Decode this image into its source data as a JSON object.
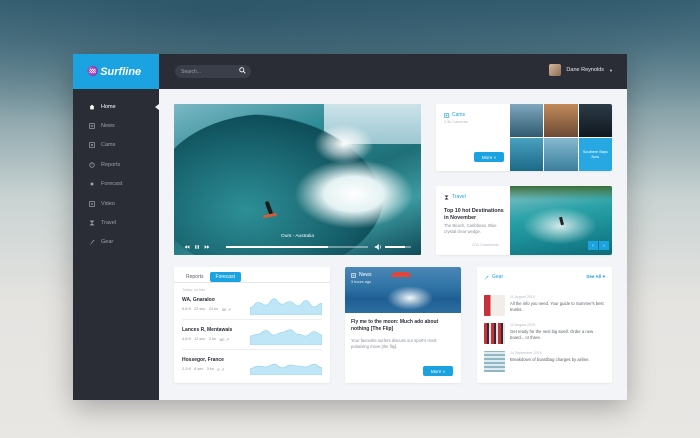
{
  "brand": {
    "name": "Surfline",
    "accent": "#1aa3e0",
    "dark": "#2a2d36"
  },
  "search": {
    "placeholder": "Search..."
  },
  "user": {
    "name": "Dane Reynolds"
  },
  "sidebar": {
    "items": [
      {
        "label": "Home",
        "icon": "home-icon",
        "active": true
      },
      {
        "label": "News",
        "icon": "news-icon"
      },
      {
        "label": "Cams",
        "icon": "camera-icon"
      },
      {
        "label": "Reports",
        "icon": "reports-icon"
      },
      {
        "label": "Forecast",
        "icon": "forecast-icon"
      },
      {
        "label": "Video",
        "icon": "video-icon"
      },
      {
        "label": "Travel",
        "icon": "travel-icon"
      },
      {
        "label": "Gear",
        "icon": "gear-icon"
      }
    ]
  },
  "video": {
    "caption": "Ours - Australia",
    "progress_fraction": 0.72,
    "volume_fraction": 0.75
  },
  "cams": {
    "label": "Cams",
    "meta": "2.3k Cameras",
    "button": "More »",
    "tile_label": "Southern Bays Now"
  },
  "travel": {
    "label": "Travel",
    "title": "Top 10 hot Destinations in November",
    "desc": "The Beach, Caribbean. Blue crystal clear wedge.",
    "meta": "2/11 Comments"
  },
  "reports": {
    "tabs": [
      "Reports",
      "Forecast"
    ],
    "active_tab": 1,
    "meta": "Today, no tide",
    "spots": [
      {
        "name": "WA, Gnaraloo",
        "stats": [
          "6-8 ft",
          "22 sec",
          "21 kn",
          "SE ↗"
        ],
        "wave": [
          0.4,
          0.7,
          0.55,
          0.9,
          0.6,
          0.75,
          0.5,
          0.8,
          0.45,
          0.65
        ]
      },
      {
        "name": "Lances R, Mentawais",
        "stats": [
          "4-6 ft",
          "12 sec",
          "2 kn",
          "NE ↗"
        ],
        "wave": [
          0.5,
          0.6,
          0.8,
          0.55,
          0.7,
          0.85,
          0.6,
          0.5,
          0.75,
          0.55
        ]
      },
      {
        "name": "Hossegor, France",
        "stats": [
          "2-3 ft",
          "8 sec",
          "3 kn",
          "E ↗"
        ],
        "wave": [
          0.35,
          0.5,
          0.45,
          0.6,
          0.4,
          0.55,
          0.5,
          0.45,
          0.6,
          0.4
        ]
      }
    ]
  },
  "news": {
    "label": "News",
    "meta": "3 hours ago",
    "title": "Fly me to the moon: Much ado about nothing [The Flip]",
    "desc": "Your favourite surfers discuss our sport's most polarising move [the flip].",
    "button": "More »"
  },
  "gear": {
    "label": "Gear",
    "see_all": "See All ▾",
    "items": [
      {
        "date": "11 August 2015",
        "text": "All the info you need. Your guide to Summer's best trunks."
      },
      {
        "date": "12 August 2015",
        "text": "Get ready for the next big swell. Order a new board... or three."
      },
      {
        "date": "14 September 2015",
        "text": "Breakdown of boardbag charges by airline."
      }
    ]
  }
}
